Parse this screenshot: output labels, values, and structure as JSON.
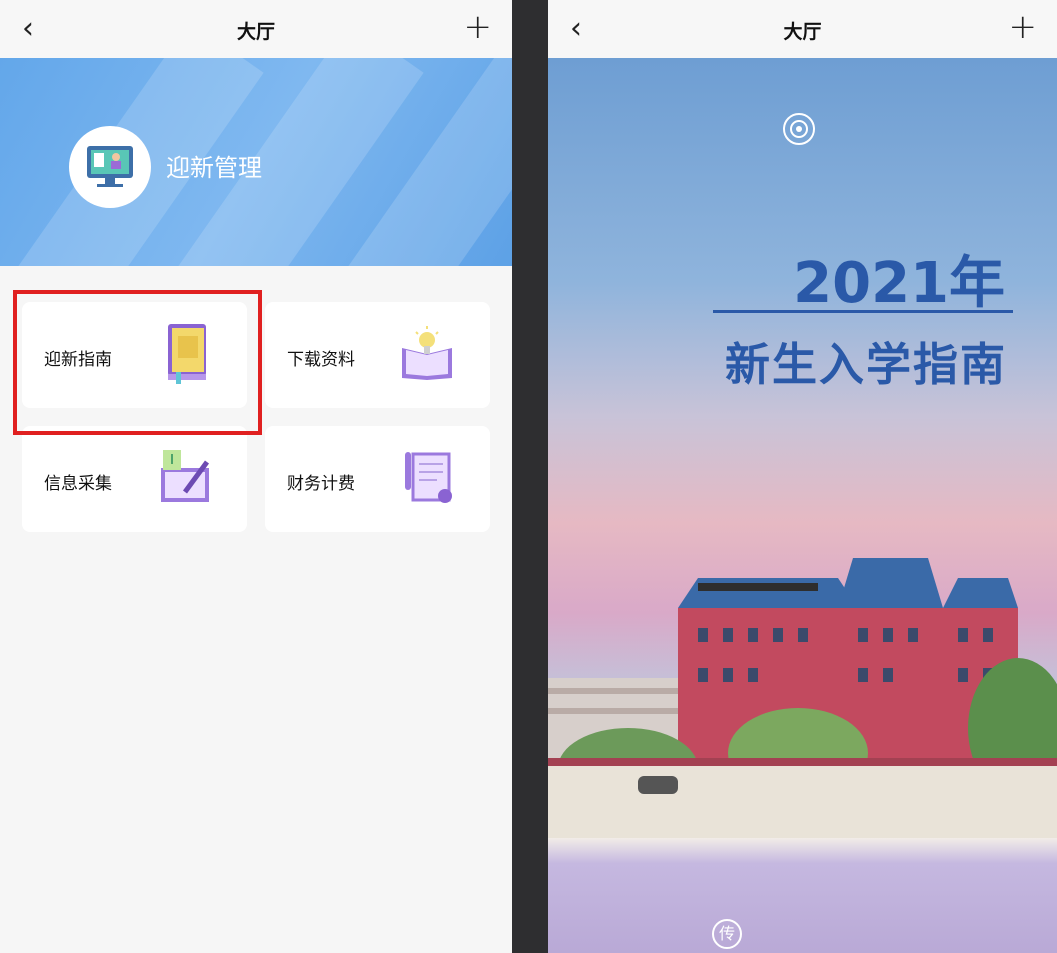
{
  "left": {
    "nav": {
      "back_icon": "chevron-left-icon",
      "title": "大厅",
      "add_icon": "plus-icon",
      "back_glyph": "‹",
      "add_glyph": "+"
    },
    "banner": {
      "icon": "computer-monitor-icon",
      "title": "迎新管理"
    },
    "cards": [
      {
        "label": "迎新指南",
        "icon": "book-icon"
      },
      {
        "label": "下载资料",
        "icon": "lightbulb-book-icon"
      },
      {
        "label": "信息采集",
        "icon": "pencil-notebook-icon"
      },
      {
        "label": "财务计费",
        "icon": "document-clip-icon"
      }
    ],
    "highlight_color": "#e02020"
  },
  "right": {
    "nav": {
      "back_icon": "chevron-left-icon",
      "title": "大厅",
      "add_icon": "plus-icon",
      "back_glyph": "‹",
      "add_glyph": "+"
    },
    "cover": {
      "college_logo": "college-emblem-icon",
      "year": "2021年",
      "title": "新生入学指南",
      "seal_text": "传"
    }
  },
  "colors": {
    "accent_blue": "#2a59a8",
    "banner_blue": "#63a7ea"
  }
}
